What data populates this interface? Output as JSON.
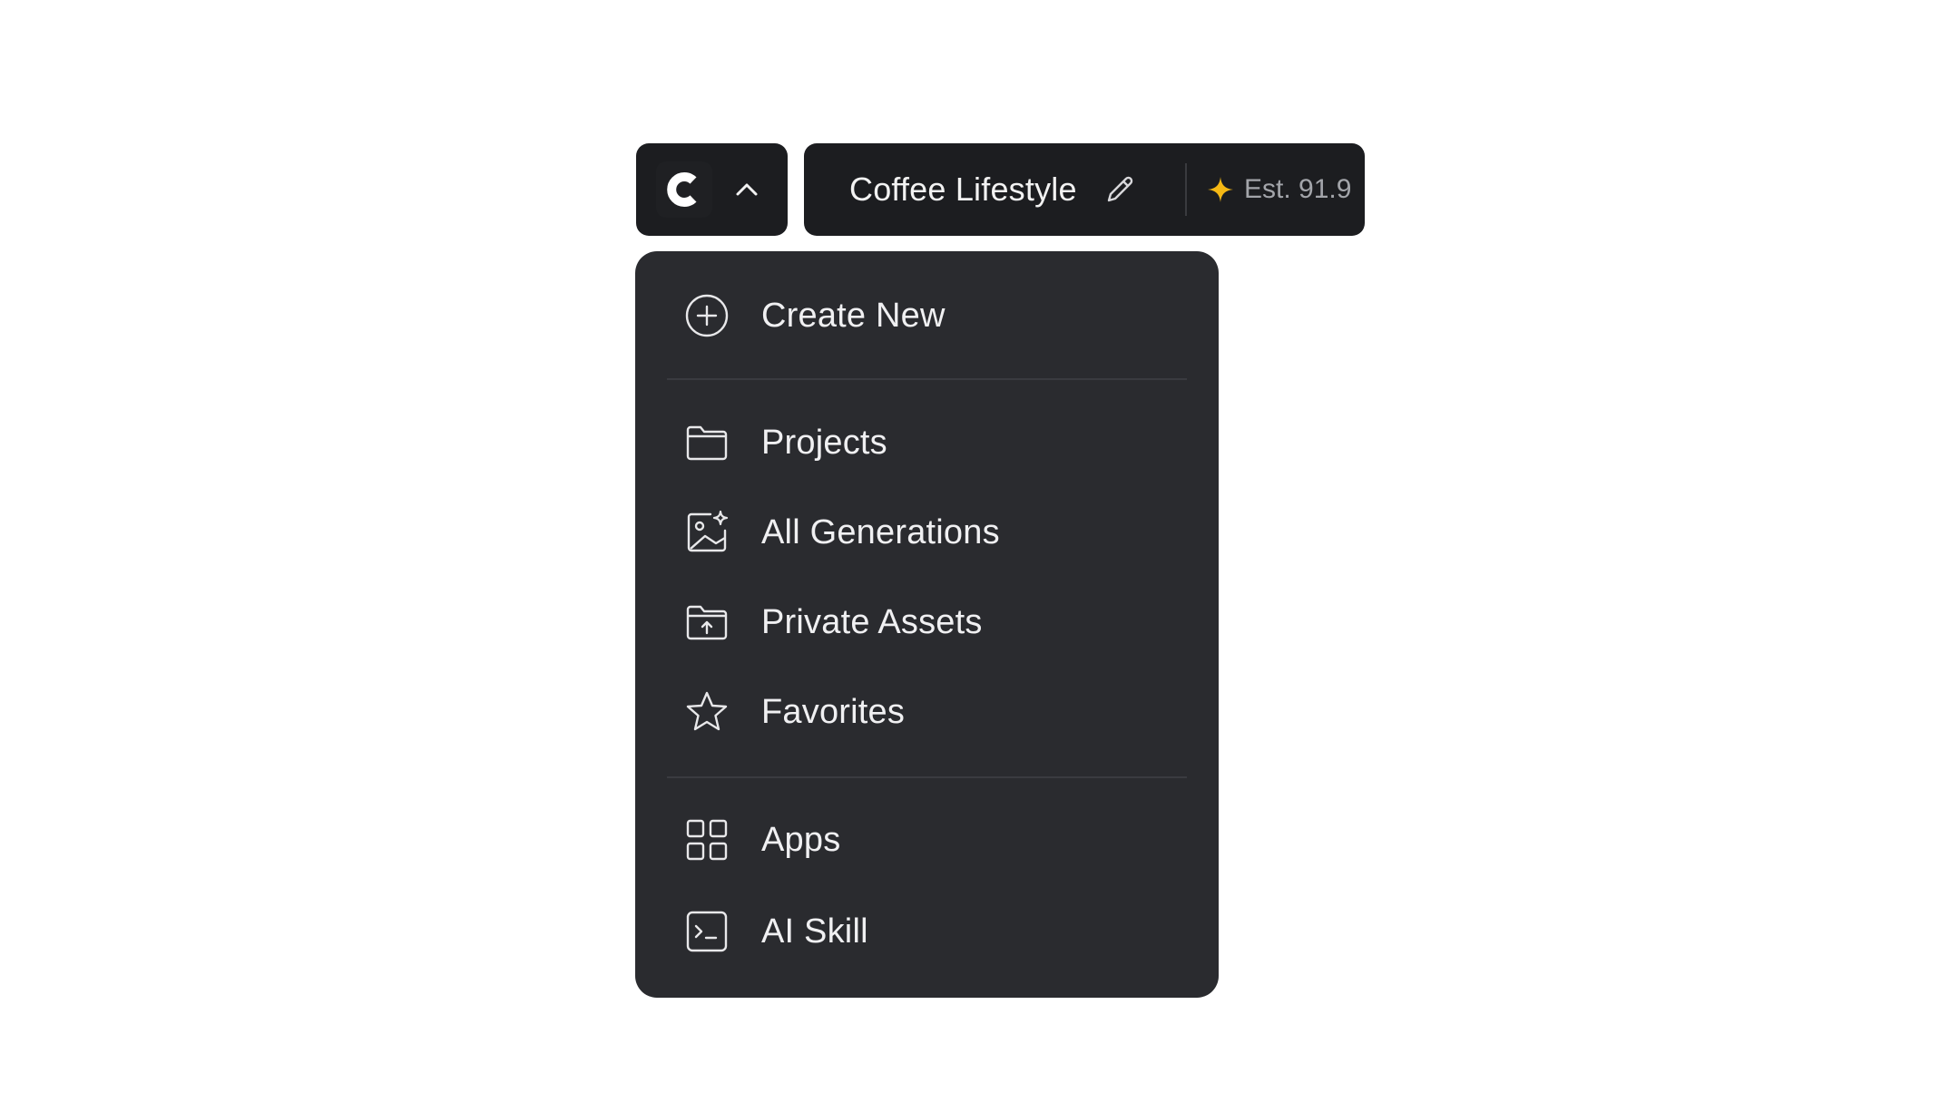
{
  "topbar": {
    "logo_icon": "c-logo-icon",
    "chevron_icon": "chevron-up-icon",
    "project_title": "Coffee Lifestyle",
    "edit_icon": "pencil-icon",
    "estimate_icon": "sparkle-icon",
    "estimate_label": "Est. 91.9",
    "accent_color": "#f5b814"
  },
  "menu": {
    "items": [
      {
        "label": "Create New",
        "icon": "plus-circle-icon"
      },
      {
        "label": "Projects",
        "icon": "folder-icon"
      },
      {
        "label": "All Generations",
        "icon": "image-sparkle-icon"
      },
      {
        "label": "Private Assets",
        "icon": "folder-upload-icon"
      },
      {
        "label": "Favorites",
        "icon": "star-icon"
      },
      {
        "label": "Apps",
        "icon": "grid-icon"
      },
      {
        "label": "AI Skill",
        "icon": "terminal-icon"
      }
    ]
  },
  "colors": {
    "background": "#ffffff",
    "pill_bg": "#1c1d20",
    "menu_bg": "#2a2b2f",
    "text": "#f0f0f2"
  }
}
